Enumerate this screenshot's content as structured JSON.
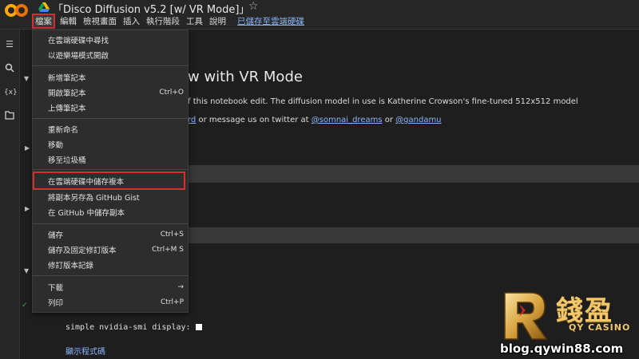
{
  "app": {
    "title": "「Disco Diffusion v5.2 [w/ VR Mode]」",
    "star_icon": "star-icon"
  },
  "menubar": {
    "items": [
      "檔案",
      "編輯",
      "檢視畫面",
      "插入",
      "執行階段",
      "工具",
      "說明"
    ],
    "saved_status": "已儲存至雲端硬碟"
  },
  "file_menu": {
    "items": [
      {
        "label": "在雲端硬碟中尋找",
        "shortcut": ""
      },
      {
        "label": "以遊樂場模式開啟",
        "shortcut": ""
      },
      {
        "label": "新增筆記本",
        "shortcut": ""
      },
      {
        "label": "開啟筆記本",
        "shortcut": "Ctrl+O"
      },
      {
        "label": "上傳筆記本",
        "shortcut": ""
      },
      {
        "label": "重新命名",
        "shortcut": ""
      },
      {
        "label": "移動",
        "shortcut": ""
      },
      {
        "label": "移至垃圾桶",
        "shortcut": ""
      },
      {
        "label": "在雲端硬碟中儲存複本",
        "shortcut": ""
      },
      {
        "label": "將副本另存為 GitHub Gist",
        "shortcut": ""
      },
      {
        "label": "在 GitHub 中儲存副本",
        "shortcut": ""
      },
      {
        "label": "儲存",
        "shortcut": "Ctrl+S"
      },
      {
        "label": "儲存及固定修訂版本",
        "shortcut": "Ctrl+M S"
      },
      {
        "label": "修訂版本記錄",
        "shortcut": ""
      },
      {
        "label": "下載",
        "shortcut": "→"
      },
      {
        "label": "列印",
        "shortcut": "Ctrl+P"
      }
    ]
  },
  "content": {
    "heading": "w with VR Mode",
    "line1": "f this notebook edit. The diffusion model in use is Katherine Crowson's fine-tuned 512x512 model",
    "line2_link1": "rd",
    "line2_text": " or message us on twitter at ",
    "line2_link2": "@somnai_dreams",
    "line2_text2": " or ",
    "line2_link3": "@gandamu",
    "mono_line": "simple nvidia-smi display:",
    "show_code": "顯示程式碼"
  },
  "brand": {
    "name_cn": "錢盈",
    "name_en": "QY CASINO",
    "url": "blog.qywin88.com"
  },
  "colors": {
    "accent": "#d32f2f",
    "link": "#8ab4f8",
    "brand_gold": "#f2c66b"
  }
}
